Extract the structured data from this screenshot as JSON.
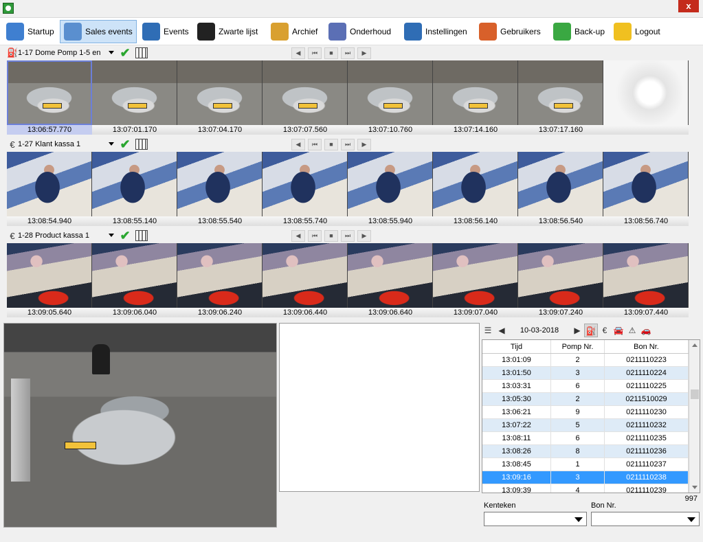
{
  "window": {
    "close_label": "x"
  },
  "toolbar": [
    {
      "label": "Startup",
      "icon": "house-icon",
      "color": "#3f7fd0"
    },
    {
      "label": "Sales events",
      "icon": "cash-register-icon",
      "color": "#5a8fcf",
      "active": true
    },
    {
      "label": "Events",
      "icon": "events-list-icon",
      "color": "#2f6db5"
    },
    {
      "label": "Zwarte lijst",
      "icon": "blacklist-icon",
      "color": "#222222"
    },
    {
      "label": "Archief",
      "icon": "archive-binder-icon",
      "color": "#d9a030"
    },
    {
      "label": "Onderhoud",
      "icon": "gears-icon",
      "color": "#5b6fb5"
    },
    {
      "label": "Instellingen",
      "icon": "settings-checklist-icon",
      "color": "#2f6db5"
    },
    {
      "label": "Gebruikers",
      "icon": "users-icon",
      "color": "#d8602a"
    },
    {
      "label": "Back-up",
      "icon": "backup-arrow-icon",
      "color": "#3aa842"
    },
    {
      "label": "Logout",
      "icon": "padlock-icon",
      "color": "#f0c020"
    }
  ],
  "cameras": [
    {
      "name": "1-17 Dome Pomp 1-5 en",
      "type_icon": "fuel-pump-icon",
      "timestamps": [
        "13:06:57.770",
        "13:07:01.170",
        "13:07:04.170",
        "13:07:07.560",
        "13:07:10.760",
        "13:07:14.160",
        "13:07:17.160",
        ""
      ],
      "selected_index": 0
    },
    {
      "name": "1-27 Klant kassa 1",
      "type_icon": "euro-icon",
      "timestamps": [
        "13:08:54.940",
        "13:08:55.140",
        "13:08:55.540",
        "13:08:55.740",
        "13:08:55.940",
        "13:08:56.140",
        "13:08:56.540",
        "13:08:56.740"
      ]
    },
    {
      "name": "1-28 Product kassa 1",
      "type_icon": "euro-icon",
      "timestamps": [
        "13:09:05.640",
        "13:09:06.040",
        "13:09:06.240",
        "13:09:06.440",
        "13:09:06.640",
        "13:09:07.040",
        "13:09:07.240",
        "13:09:07.440"
      ]
    }
  ],
  "date_nav": {
    "date": "10-03-2018"
  },
  "table": {
    "columns": [
      "Tijd",
      "Pomp Nr.",
      "Bon Nr."
    ],
    "rows": [
      [
        "13:01:09",
        "2",
        "0211110223"
      ],
      [
        "13:01:50",
        "3",
        "0211110224"
      ],
      [
        "13:03:31",
        "6",
        "0211110225"
      ],
      [
        "13:05:30",
        "2",
        "0211510029"
      ],
      [
        "13:06:21",
        "9",
        "0211110230"
      ],
      [
        "13:07:22",
        "5",
        "0211110232"
      ],
      [
        "13:08:11",
        "6",
        "0211110235"
      ],
      [
        "13:08:26",
        "8",
        "0211110236"
      ],
      [
        "13:08:45",
        "1",
        "0211110237"
      ],
      [
        "13:09:16",
        "3",
        "0211110238"
      ],
      [
        "13:09:39",
        "4",
        "0211110239"
      ]
    ],
    "selected_row": 9,
    "count": "997"
  },
  "filters": {
    "kenteken_label": "Kenteken",
    "bon_label": "Bon Nr."
  },
  "colors": {
    "selection": "#3399ff",
    "alt_row": "#deebf7",
    "active_tab": "#cde3f8"
  }
}
